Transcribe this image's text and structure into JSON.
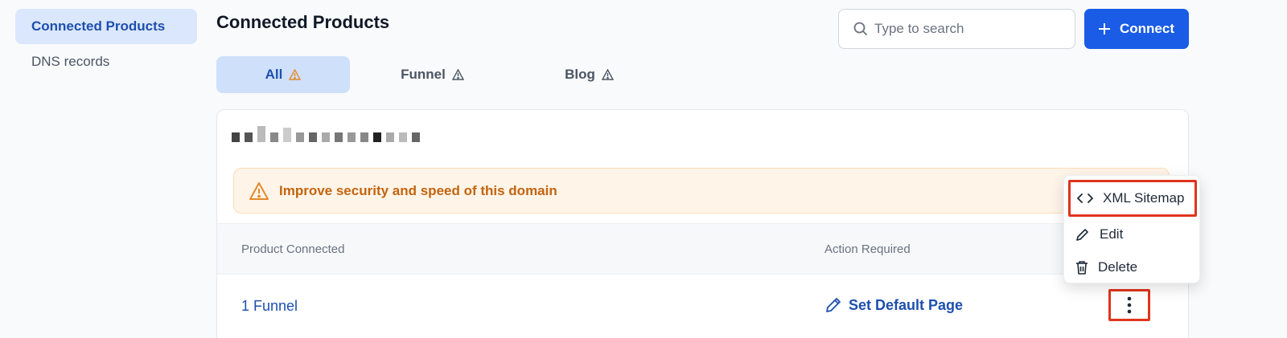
{
  "sidebar": {
    "items": [
      {
        "label": "Connected Products"
      },
      {
        "label": "DNS records"
      }
    ]
  },
  "header": {
    "title": "Connected Products",
    "search_placeholder": "Type to search",
    "connect_label": "Connect"
  },
  "tabs": [
    {
      "label": "All"
    },
    {
      "label": "Funnel"
    },
    {
      "label": "Blog"
    }
  ],
  "card": {
    "alert_text": "Improve security and speed of this domain",
    "columns": [
      "Product Connected",
      "Action Required"
    ],
    "row": {
      "product": "1 Funnel",
      "action": "Set Default Page"
    }
  },
  "menu": {
    "items": [
      {
        "label": "XML Sitemap",
        "icon": "code-icon"
      },
      {
        "label": "Edit",
        "icon": "pencil-icon"
      },
      {
        "label": "Delete",
        "icon": "trash-icon"
      }
    ]
  },
  "colors": {
    "primary": "#1a5ce6",
    "accent_text": "#1d4fae",
    "warning": "#c2640f",
    "highlight_outline": "#e0341d"
  }
}
